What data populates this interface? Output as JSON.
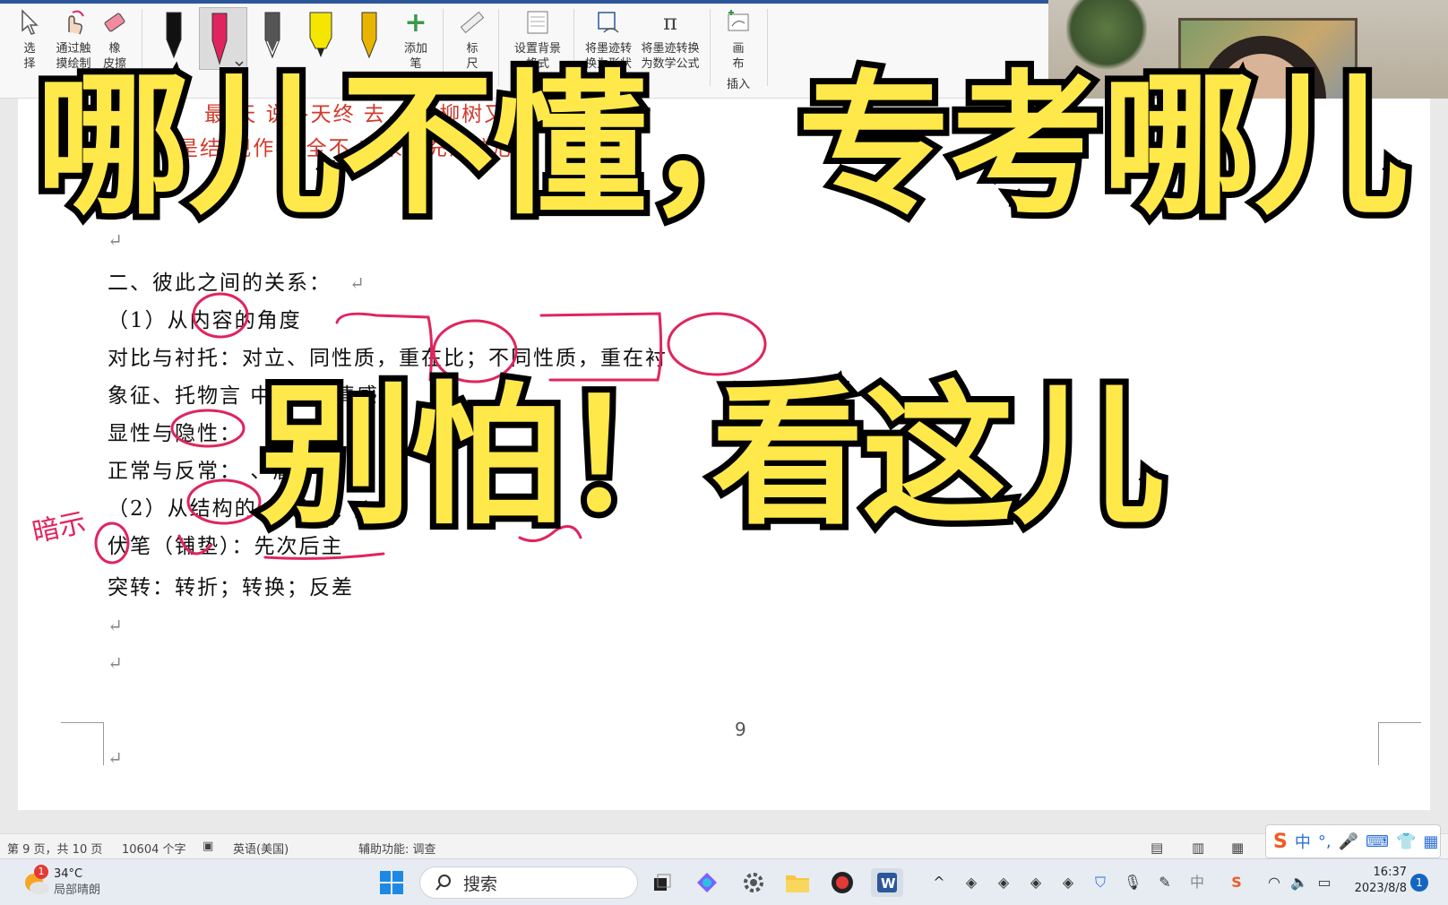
{
  "ribbon": {
    "tools": [
      {
        "label": "选\n择",
        "icon": "cursor-icon"
      },
      {
        "label": "通过触\n摸绘制",
        "icon": "touch-draw-icon"
      },
      {
        "label": "橡\n皮擦",
        "icon": "eraser-icon"
      },
      {
        "label": "添加\n笔",
        "icon": "add-pen-icon"
      },
      {
        "label": "标\n尺",
        "icon": "ruler-icon"
      },
      {
        "label": "设置背景\n格式",
        "icon": "background-icon"
      },
      {
        "label": "将墨迹转\n换为形状",
        "icon": "ink-to-shape-icon"
      },
      {
        "label": "将墨迹转换\n为数学公式",
        "icon": "ink-to-math-icon"
      },
      {
        "label": "画\n布",
        "icon": "canvas-icon"
      }
    ],
    "group_label": "插入",
    "pens": [
      "#111111",
      "#e0245e",
      "#444444",
      "#f5e600",
      "#e8b400"
    ]
  },
  "document": {
    "red_line_1": "最       天       说冬天终       去，          ，柳树又会充",
    "red_line_2": "是结       现作者       全不       对未来充满信心",
    "section_heading": "二、彼此之间的关系：",
    "item_1": "（1）从内容的角度",
    "line_contrast": "对比与衬托：对立、同性质，重在比；不同性质，重在衬",
    "line_symbol": "象征、托物言        中       予     的情感，",
    "line_explicit": "显性与隐性：",
    "line_normal": "正常与反常：                              、盾冲突",
    "item_2": "（2）从结构的",
    "line_foreshadow": "伏笔（铺垫）：先次后主",
    "line_turn": "突转：转折；转换；反差",
    "handwriting_left": "暗示",
    "page_number": "9",
    "para_mark": "↵"
  },
  "overlay": {
    "title_top": "哪儿不懂，专考哪儿",
    "title_bottom": "别怕！看这儿"
  },
  "status_bar": {
    "page": "第 9 页，共 10 页",
    "words": "10604 个字",
    "language": "英语(美国)",
    "accessibility": "辅助功能: 调查"
  },
  "taskbar": {
    "weather_temp": "34°C",
    "weather_desc": "局部晴朗",
    "weather_badge": "1",
    "search_placeholder": "搜索",
    "time": "16:37",
    "date": "2023/8/8",
    "notification_count": "1",
    "ime_label": "中"
  }
}
